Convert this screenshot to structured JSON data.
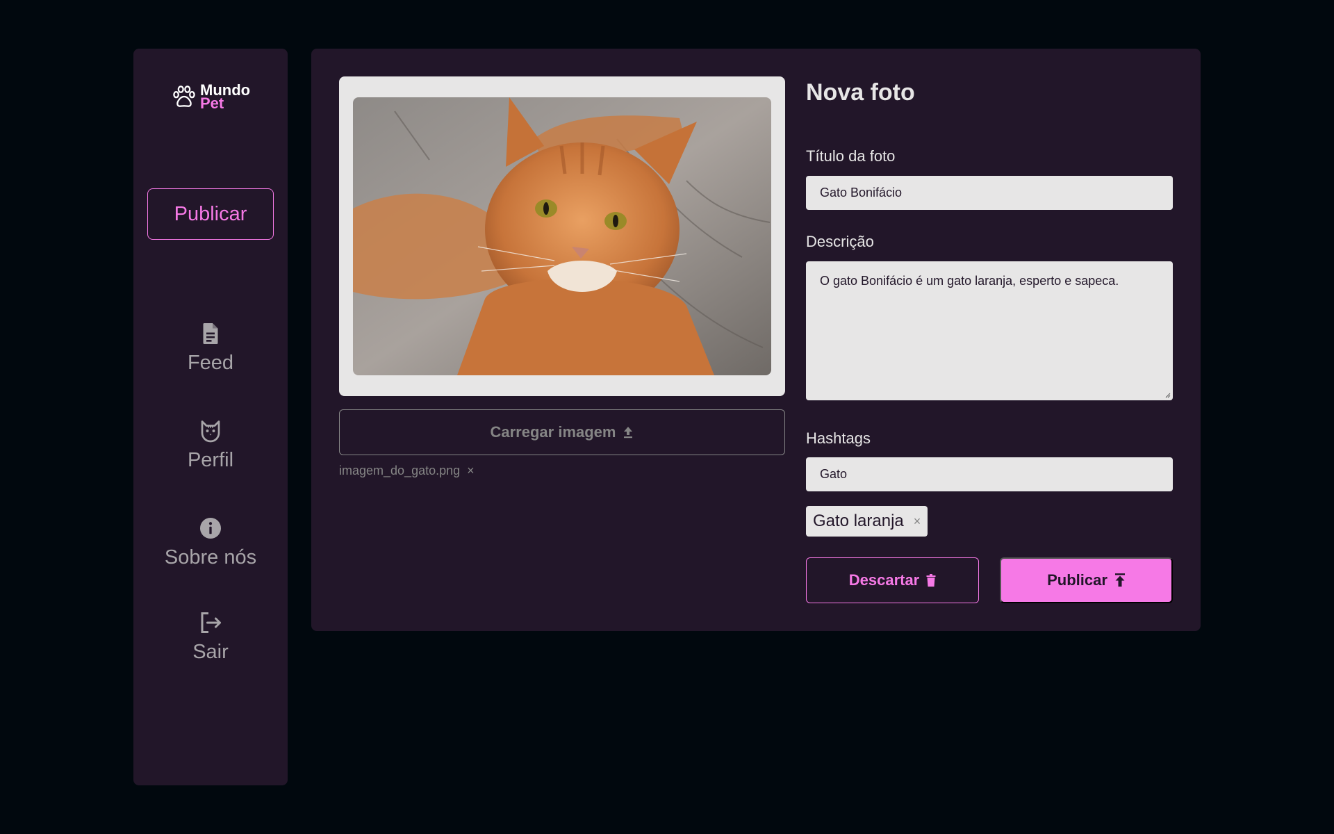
{
  "colors": {
    "background": "#01080e",
    "panel": "#221629",
    "accent": "#f679e6",
    "muted": "#a8a5a9",
    "field": "#e7e6e6"
  },
  "logo": {
    "line1": "Mundo",
    "line2": "Pet",
    "icon": "paw-icon"
  },
  "sidebar": {
    "active_item": "Publicar",
    "items": [
      {
        "label": "Feed",
        "icon": "document-icon"
      },
      {
        "label": "Perfil",
        "icon": "cat-face-icon"
      },
      {
        "label": "Sobre nós",
        "icon": "info-icon"
      },
      {
        "label": "Sair",
        "icon": "logout-icon"
      }
    ]
  },
  "upload": {
    "button_label": "Carregar imagem",
    "button_icon": "upload-icon",
    "file_name": "imagem_do_gato.png",
    "remove_symbol": "×"
  },
  "form": {
    "title": "Nova foto",
    "titulo_label": "Título da foto",
    "titulo_value": "Gato Bonifácio",
    "descricao_label": "Descrição",
    "descricao_value": "O gato Bonifácio é um gato laranja, esperto e sapeca.",
    "hashtags_label": "Hashtags",
    "hashtags_value": "Gato",
    "tags": [
      {
        "label": "Gato laranja",
        "remove_symbol": "×"
      }
    ]
  },
  "actions": {
    "discard_label": "Descartar",
    "discard_icon": "trash-icon",
    "publish_label": "Publicar",
    "publish_icon": "upload-bar-icon"
  }
}
